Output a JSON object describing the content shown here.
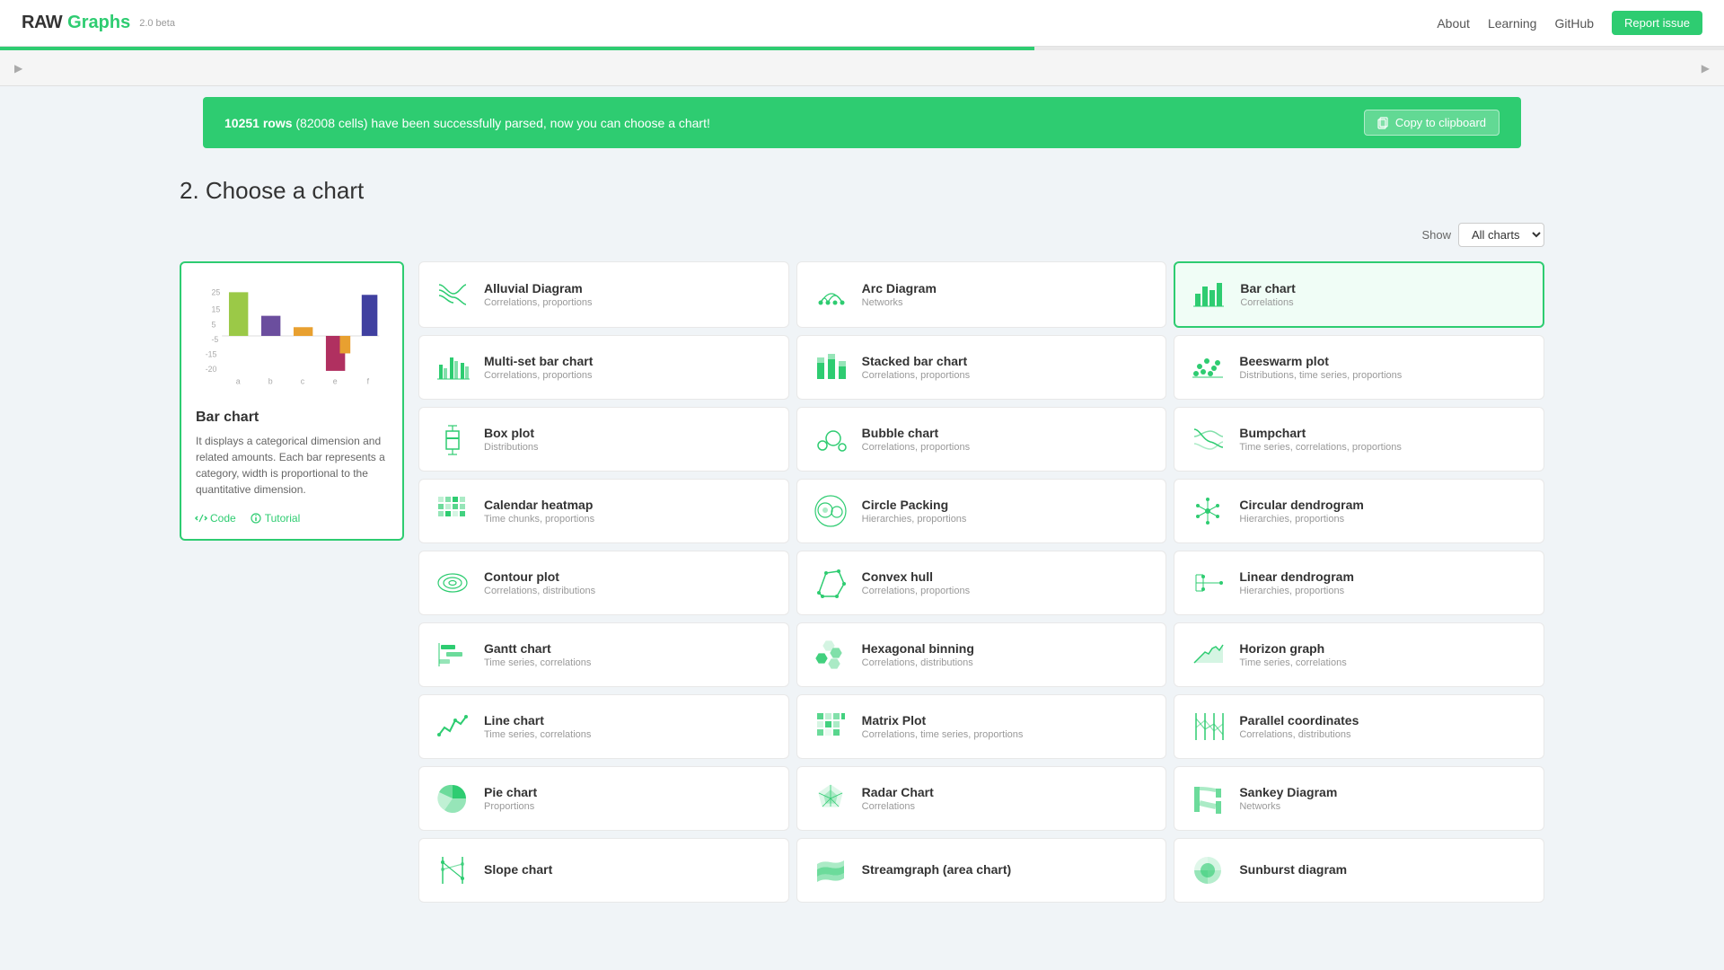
{
  "header": {
    "logo_raw": "RAW",
    "logo_graphs": "Graphs",
    "beta": "2.0 beta",
    "nav": [
      "About",
      "Learning",
      "GitHub"
    ],
    "report_issue": "Report issue"
  },
  "success_bar": {
    "message_prefix": "10251 rows",
    "message_mid": " (82008 cells) have been successfully parsed, now you can choose a chart!",
    "copy_label": "Copy to clipboard"
  },
  "section": {
    "title": "2. Choose a chart",
    "show_label": "Show",
    "show_value": "All charts"
  },
  "preview": {
    "title": "Bar chart",
    "description": "It displays a categorical dimension and related amounts. Each bar represents a category, width is proportional to the quantitative dimension.",
    "link_code": "Code",
    "link_tutorial": "Tutorial"
  },
  "charts": [
    {
      "name": "Alluvial Diagram",
      "category": "Correlations, proportions",
      "icon": "alluvial"
    },
    {
      "name": "Arc Diagram",
      "category": "Networks",
      "icon": "arc"
    },
    {
      "name": "Bar chart",
      "category": "Correlations",
      "icon": "bar",
      "active": true
    },
    {
      "name": "Multi-set bar chart",
      "category": "Correlations, proportions",
      "icon": "multibar"
    },
    {
      "name": "Stacked bar chart",
      "category": "Correlations, proportions",
      "icon": "stackedbar"
    },
    {
      "name": "Beeswarm plot",
      "category": "Distributions, time series, proportions",
      "icon": "beeswarm"
    },
    {
      "name": "Box plot",
      "category": "Distributions",
      "icon": "boxplot"
    },
    {
      "name": "Bubble chart",
      "category": "Correlations, proportions",
      "icon": "bubble"
    },
    {
      "name": "Bumpchart",
      "category": "Time series, correlations, proportions",
      "icon": "bump"
    },
    {
      "name": "Calendar heatmap",
      "category": "Time chunks, proportions",
      "icon": "calendar"
    },
    {
      "name": "Circle Packing",
      "category": "Hierarchies, proportions",
      "icon": "circlepack"
    },
    {
      "name": "Circular dendrogram",
      "category": "Hierarchies, proportions",
      "icon": "circulardendrogram"
    },
    {
      "name": "Contour plot",
      "category": "Correlations, distributions",
      "icon": "contour"
    },
    {
      "name": "Convex hull",
      "category": "Correlations, proportions",
      "icon": "convex"
    },
    {
      "name": "Linear dendrogram",
      "category": "Hierarchies, proportions",
      "icon": "lineardendrogram"
    },
    {
      "name": "Gantt chart",
      "category": "Time series, correlations",
      "icon": "gantt"
    },
    {
      "name": "Hexagonal binning",
      "category": "Correlations, distributions",
      "icon": "hexbin"
    },
    {
      "name": "Horizon graph",
      "category": "Time series, correlations",
      "icon": "horizon"
    },
    {
      "name": "Line chart",
      "category": "Time series, correlations",
      "icon": "line"
    },
    {
      "name": "Matrix Plot",
      "category": "Correlations, time series, proportions",
      "icon": "matrix"
    },
    {
      "name": "Parallel coordinates",
      "category": "Correlations, distributions",
      "icon": "parallel"
    },
    {
      "name": "Pie chart",
      "category": "Proportions",
      "icon": "pie"
    },
    {
      "name": "Radar Chart",
      "category": "Correlations",
      "icon": "radar"
    },
    {
      "name": "Sankey Diagram",
      "category": "Networks",
      "icon": "sankey"
    },
    {
      "name": "Slope chart",
      "category": "",
      "icon": "slope"
    },
    {
      "name": "Streamgraph (area chart)",
      "category": "",
      "icon": "stream"
    },
    {
      "name": "Sunburst diagram",
      "category": "",
      "icon": "sunburst"
    }
  ]
}
